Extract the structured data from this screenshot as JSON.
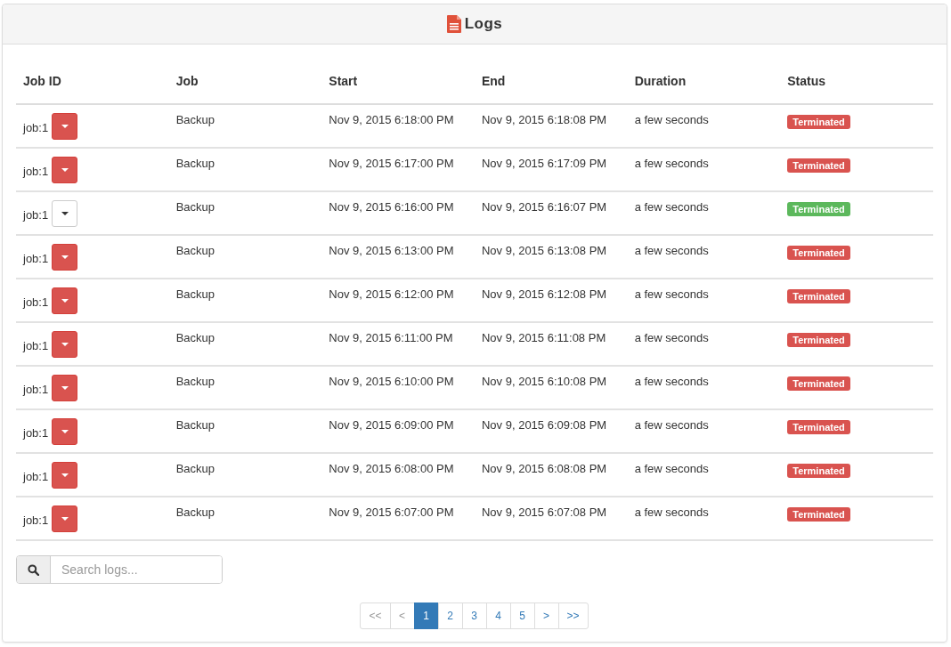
{
  "panel": {
    "title": "Logs"
  },
  "table": {
    "columns": [
      "Job ID",
      "Job",
      "Start",
      "End",
      "Duration",
      "Status"
    ],
    "rows": [
      {
        "job_id": "job:1",
        "kind": "danger",
        "job": "Backup",
        "start": "Nov 9, 2015 6:18:00 PM",
        "end": "Nov 9, 2015 6:18:08 PM",
        "duration": "a few seconds",
        "status": "Terminated",
        "color": "#d9534f"
      },
      {
        "job_id": "job:1",
        "kind": "danger",
        "job": "Backup",
        "start": "Nov 9, 2015 6:17:00 PM",
        "end": "Nov 9, 2015 6:17:09 PM",
        "duration": "a few seconds",
        "status": "Terminated",
        "color": "#d9534f"
      },
      {
        "job_id": "job:1",
        "kind": "default",
        "job": "Backup",
        "start": "Nov 9, 2015 6:16:00 PM",
        "end": "Nov 9, 2015 6:16:07 PM",
        "duration": "a few seconds",
        "status": "Terminated",
        "color": "#5cb85c"
      },
      {
        "job_id": "job:1",
        "kind": "danger",
        "job": "Backup",
        "start": "Nov 9, 2015 6:13:00 PM",
        "end": "Nov 9, 2015 6:13:08 PM",
        "duration": "a few seconds",
        "status": "Terminated",
        "color": "#d9534f"
      },
      {
        "job_id": "job:1",
        "kind": "danger",
        "job": "Backup",
        "start": "Nov 9, 2015 6:12:00 PM",
        "end": "Nov 9, 2015 6:12:08 PM",
        "duration": "a few seconds",
        "status": "Terminated",
        "color": "#d9534f"
      },
      {
        "job_id": "job:1",
        "kind": "danger",
        "job": "Backup",
        "start": "Nov 9, 2015 6:11:00 PM",
        "end": "Nov 9, 2015 6:11:08 PM",
        "duration": "a few seconds",
        "status": "Terminated",
        "color": "#d9534f"
      },
      {
        "job_id": "job:1",
        "kind": "danger",
        "job": "Backup",
        "start": "Nov 9, 2015 6:10:00 PM",
        "end": "Nov 9, 2015 6:10:08 PM",
        "duration": "a few seconds",
        "status": "Terminated",
        "color": "#d9534f"
      },
      {
        "job_id": "job:1",
        "kind": "danger",
        "job": "Backup",
        "start": "Nov 9, 2015 6:09:00 PM",
        "end": "Nov 9, 2015 6:09:08 PM",
        "duration": "a few seconds",
        "status": "Terminated",
        "color": "#d9534f"
      },
      {
        "job_id": "job:1",
        "kind": "danger",
        "job": "Backup",
        "start": "Nov 9, 2015 6:08:00 PM",
        "end": "Nov 9, 2015 6:08:08 PM",
        "duration": "a few seconds",
        "status": "Terminated",
        "color": "#d9534f"
      },
      {
        "job_id": "job:1",
        "kind": "danger",
        "job": "Backup",
        "start": "Nov 9, 2015 6:07:00 PM",
        "end": "Nov 9, 2015 6:07:08 PM",
        "duration": "a few seconds",
        "status": "Terminated",
        "color": "#d9534f"
      }
    ]
  },
  "search": {
    "placeholder": "Search logs..."
  },
  "pagination": [
    {
      "label": "<<",
      "selected": false,
      "disabled": true
    },
    {
      "label": "<",
      "selected": false,
      "disabled": true
    },
    {
      "label": "1",
      "selected": true,
      "disabled": false
    },
    {
      "label": "2",
      "selected": false,
      "disabled": false
    },
    {
      "label": "3",
      "selected": false,
      "disabled": false
    },
    {
      "label": "4",
      "selected": false,
      "disabled": false
    },
    {
      "label": "5",
      "selected": false,
      "disabled": false
    },
    {
      "label": ">",
      "selected": false,
      "disabled": false
    },
    {
      "label": ">>",
      "selected": false,
      "disabled": false
    }
  ]
}
